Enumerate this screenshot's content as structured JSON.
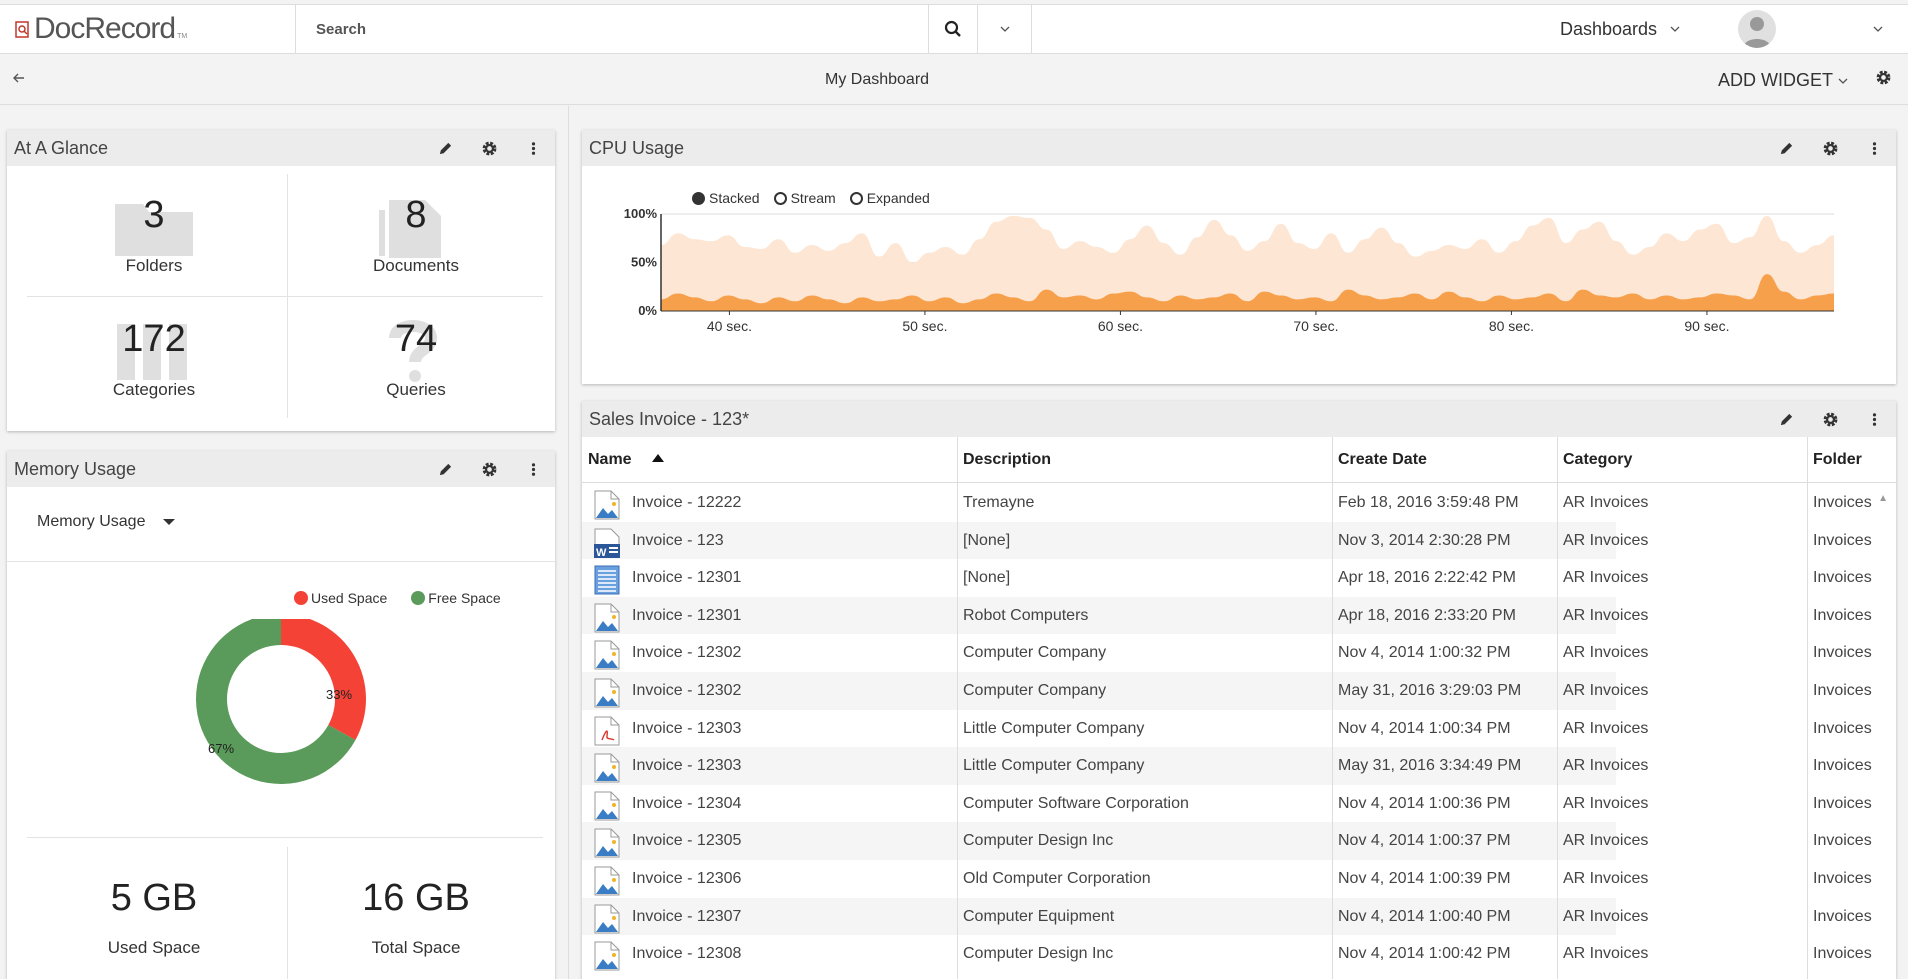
{
  "app": {
    "name": "DocRecord",
    "tm": "TM"
  },
  "search": {
    "placeholder": "Search"
  },
  "nav": {
    "dashboards_label": "Dashboards"
  },
  "page": {
    "title": "My Dashboard",
    "add_widget_label": "ADD WIDGET"
  },
  "colors": {
    "accent_orange": "#f7a04b",
    "light_orange": "#fde6d3",
    "used_red": "#f44336",
    "free_green": "#5a9a5a"
  },
  "glance": {
    "title": "At A Glance",
    "stats": [
      {
        "value": "3",
        "label": "Folders",
        "icon": "folder-icon"
      },
      {
        "value": "8",
        "label": "Documents",
        "icon": "documents-icon"
      },
      {
        "value": "172",
        "label": "Categories",
        "icon": "categories-icon"
      },
      {
        "value": "74",
        "label": "Queries",
        "icon": "query-icon"
      }
    ]
  },
  "memory": {
    "title": "Memory Usage",
    "select_value": "Memory Usage",
    "legend": [
      {
        "label": "Used Space",
        "color": "#f44336"
      },
      {
        "label": "Free Space",
        "color": "#5a9a5a"
      }
    ],
    "used_pct": 33,
    "free_pct": 67,
    "used_pct_label": "33%",
    "free_pct_label": "67%",
    "used_value": "5 GB",
    "used_label": "Used Space",
    "total_value": "16 GB",
    "total_label": "Total Space"
  },
  "cpu": {
    "title": "CPU Usage",
    "modes": [
      "Stacked",
      "Stream",
      "Expanded"
    ],
    "selected_mode": "Stacked",
    "y_ticks": [
      "100%",
      "50%",
      "0%"
    ],
    "x_ticks": [
      "40 sec.",
      "50 sec.",
      "60 sec.",
      "70 sec.",
      "80 sec.",
      "90 sec."
    ],
    "x_range": [
      36.5,
      96.5
    ],
    "series_top": [
      68,
      80,
      74,
      72,
      78,
      66,
      64,
      74,
      60,
      68,
      62,
      70,
      80,
      56,
      70,
      50,
      60,
      66,
      58,
      74,
      92,
      98,
      96,
      84,
      64,
      72,
      66,
      60,
      74,
      88,
      70,
      58,
      76,
      94,
      78,
      62,
      72,
      90,
      70,
      64,
      80,
      60,
      74,
      86,
      70,
      56,
      62,
      68,
      64,
      74,
      60,
      72,
      88,
      96,
      70,
      84,
      92,
      72,
      58,
      66,
      80,
      72,
      84,
      90,
      70,
      76,
      98,
      72,
      60,
      68,
      78
    ],
    "series_bottom": [
      12,
      18,
      14,
      10,
      16,
      12,
      8,
      14,
      10,
      16,
      12,
      8,
      14,
      10,
      12,
      16,
      10,
      14,
      8,
      12,
      18,
      14,
      10,
      22,
      14,
      16,
      12,
      18,
      20,
      14,
      10,
      16,
      12,
      14,
      18,
      10,
      20,
      16,
      12,
      14,
      10,
      22,
      16,
      12,
      14,
      18,
      12,
      20,
      14,
      10,
      16,
      12,
      14,
      18,
      10,
      22,
      16,
      14,
      18,
      12,
      16,
      12,
      14,
      18,
      16,
      12,
      38,
      20,
      12,
      16,
      18
    ]
  },
  "invoice": {
    "title": "Sales Invoice - 123*",
    "columns": [
      "Name",
      "Description",
      "Create Date",
      "Category",
      "Folder"
    ],
    "rows": [
      {
        "icon": "image-doc-icon",
        "name": "Invoice - 12222",
        "description": "Tremayne",
        "date": "Feb 18, 2016 3:59:48 PM",
        "category": "AR Invoices",
        "folder": "Invoices"
      },
      {
        "icon": "word-doc-icon",
        "name": "Invoice - 123",
        "description": "[None]",
        "date": "Nov 3, 2014 2:30:28 PM",
        "category": "AR Invoices",
        "folder": "Invoices"
      },
      {
        "icon": "text-doc-icon",
        "name": "Invoice - 12301",
        "description": "[None]",
        "date": "Apr 18, 2016 2:22:42 PM",
        "category": "AR Invoices",
        "folder": "Invoices"
      },
      {
        "icon": "image-doc-icon",
        "name": "Invoice - 12301",
        "description": "Robot Computers",
        "date": "Apr 18, 2016 2:33:20 PM",
        "category": "AR Invoices",
        "folder": "Invoices"
      },
      {
        "icon": "image-doc-icon",
        "name": "Invoice - 12302",
        "description": "Computer Company",
        "date": "Nov 4, 2014 1:00:32 PM",
        "category": "AR Invoices",
        "folder": "Invoices"
      },
      {
        "icon": "image-doc-icon",
        "name": "Invoice - 12302",
        "description": "Computer Company",
        "date": "May 31, 2016 3:29:03 PM",
        "category": "AR Invoices",
        "folder": "Invoices"
      },
      {
        "icon": "pdf-doc-icon",
        "name": "Invoice - 12303",
        "description": "Little Computer Company",
        "date": "Nov 4, 2014 1:00:34 PM",
        "category": "AR Invoices",
        "folder": "Invoices"
      },
      {
        "icon": "image-doc-icon",
        "name": "Invoice - 12303",
        "description": "Little Computer Company",
        "date": "May 31, 2016 3:34:49 PM",
        "category": "AR Invoices",
        "folder": "Invoices"
      },
      {
        "icon": "image-doc-icon",
        "name": "Invoice - 12304",
        "description": "Computer Software Corporation",
        "date": "Nov 4, 2014 1:00:36 PM",
        "category": "AR Invoices",
        "folder": "Invoices"
      },
      {
        "icon": "image-doc-icon",
        "name": "Invoice - 12305",
        "description": "Computer Design Inc",
        "date": "Nov 4, 2014 1:00:37 PM",
        "category": "AR Invoices",
        "folder": "Invoices"
      },
      {
        "icon": "image-doc-icon",
        "name": "Invoice - 12306",
        "description": "Old Computer Corporation",
        "date": "Nov 4, 2014 1:00:39 PM",
        "category": "AR Invoices",
        "folder": "Invoices"
      },
      {
        "icon": "image-doc-icon",
        "name": "Invoice - 12307",
        "description": "Computer Equipment",
        "date": "Nov 4, 2014 1:00:40 PM",
        "category": "AR Invoices",
        "folder": "Invoices"
      },
      {
        "icon": "image-doc-icon",
        "name": "Invoice - 12308",
        "description": "Computer Design Inc",
        "date": "Nov 4, 2014 1:00:42 PM",
        "category": "AR Invoices",
        "folder": "Invoices"
      }
    ]
  }
}
